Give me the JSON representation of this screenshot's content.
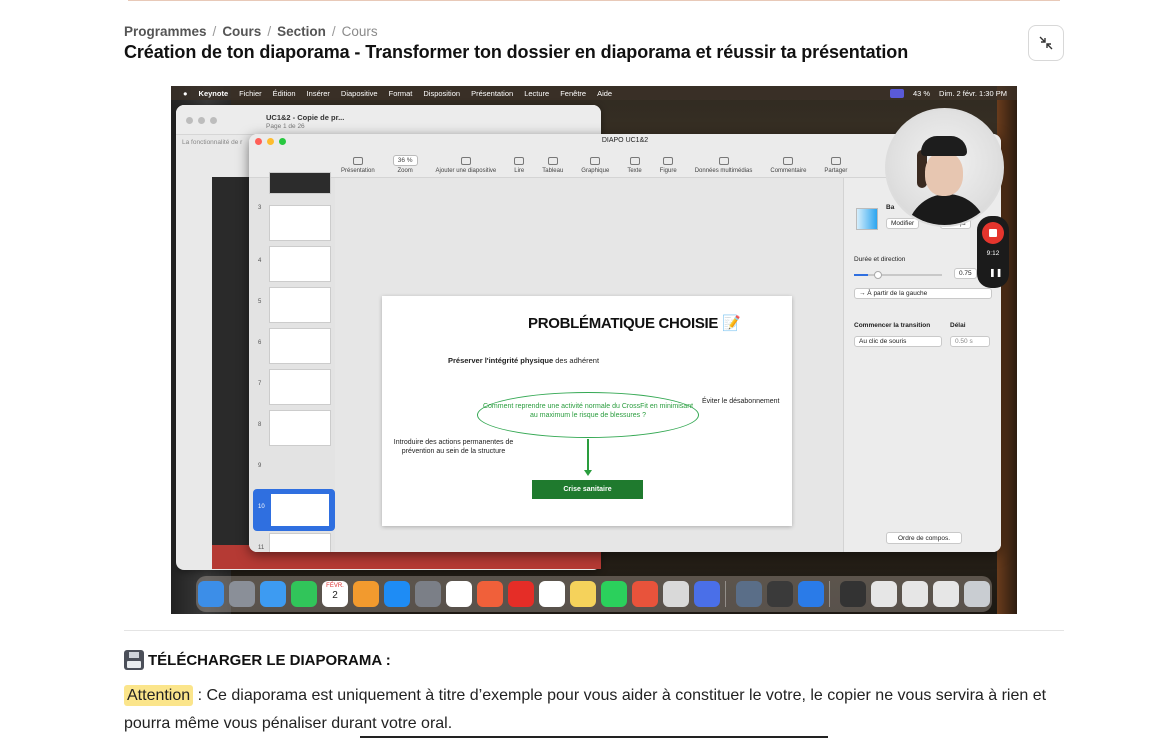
{
  "breadcrumb": {
    "items": [
      "Programmes",
      "Cours",
      "Section"
    ],
    "current": "Cours",
    "separator": "/"
  },
  "page": {
    "title": "Création de ton diaporama - Transformer ton dossier en diaporama et réussir ta présentation"
  },
  "video": {
    "menubar": {
      "app": "Keynote",
      "items": [
        "Fichier",
        "Édition",
        "Insérer",
        "Diapositive",
        "Format",
        "Disposition",
        "Présentation",
        "Lecture",
        "Fenêtre",
        "Aide"
      ],
      "battery": "43 %",
      "datetime": "Dim. 2 févr.  1:30 PM"
    },
    "bg_window": {
      "title": "UC1&2 - Copie de pr...",
      "subtitle": "Page 1 de 26",
      "note": "La fonctionnalité de r"
    },
    "keynote": {
      "doc_title": "DIAPO UC1&2",
      "toolbar": [
        "Présentation",
        "Zoom",
        "Ajouter une diapositive",
        "Lire",
        "Tableau",
        "Graphique",
        "Texte",
        "Figure",
        "Données multimédias",
        "Commentaire",
        "Partager"
      ],
      "zoom_value": "36 %",
      "slide_numbers": [
        "3",
        "4",
        "5",
        "6",
        "7",
        "8",
        "9",
        "10",
        "11"
      ],
      "slide": {
        "title": "PROBLÉMATIQUE CHOISIE 📝",
        "subtitle_bold": "Préserver l'intégrité physique",
        "subtitle_rest": " des adhérent",
        "question": "Comment reprendre une activité normale du CrossFit en minimisant au maximum le risque de blessures ?",
        "right_note": "Éviter le désabonnement",
        "left_note": "Introduire des actions permanentes de prévention au sein de la structure",
        "box": "Crise sanitaire"
      },
      "inspector": {
        "heading": "Ba",
        "modify": "Modifier",
        "preview": "Aperçu",
        "duration_label": "Durée et direction",
        "duration_value": "0.75",
        "direction": "→  À partir de la gauche",
        "start_label": "Commencer la transition",
        "start_value": "Au clic de souris",
        "delay_label": "Délai",
        "delay_value": "0.50 s",
        "order_button": "Ordre de compos."
      }
    },
    "recording": {
      "time": "9:12"
    },
    "dock_calendar": {
      "month": "FÉVR.",
      "day": "2"
    }
  },
  "download": {
    "icon": "floppy-disk-icon",
    "label": "TÉLÉCHARGER LE DIAPORAMA :"
  },
  "notice": {
    "highlight": "Attention",
    "text": " : Ce diaporama est uniquement à titre d’exemple pour vous aider à constituer le votre, le copier ne vous servira à rien et pourra même vous pénaliser durant votre oral."
  },
  "colors": {
    "highlight": "#fbe58b",
    "accent_green": "#1f7a2e",
    "record_red": "#e5352d",
    "selection_blue": "#2f6fe0"
  }
}
